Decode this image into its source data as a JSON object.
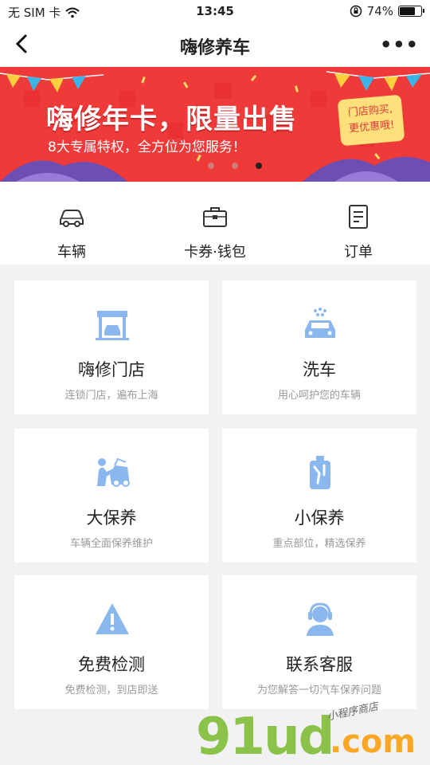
{
  "statusbar": {
    "carrier": "无 SIM 卡",
    "time": "13:45",
    "battery": "74%",
    "battery_level": 0.74
  },
  "navbar": {
    "title": "嗨修养车",
    "more": "•••"
  },
  "banner": {
    "headline": "嗨修年卡，限量出售",
    "subtitle": "8大专属特权，全方位为您服务！",
    "badge_line1": "门店购买,",
    "badge_line2": "更优惠哦!",
    "active_dot": 2,
    "bg_color": "#ef3a3a"
  },
  "quick": [
    {
      "label": "车辆",
      "icon": "car-icon"
    },
    {
      "label": "卡券·钱包",
      "icon": "briefcase-icon"
    },
    {
      "label": "订单",
      "icon": "document-icon"
    }
  ],
  "services": [
    {
      "title": "嗨修门店",
      "desc": "连锁门店，遍布上海",
      "icon": "garage-icon"
    },
    {
      "title": "洗车",
      "desc": "用心呵护您的车辆",
      "icon": "car-wash-icon"
    },
    {
      "title": "大保养",
      "desc": "车辆全面保养维护",
      "icon": "mechanic-icon"
    },
    {
      "title": "小保养",
      "desc": "重点部位，精选保养",
      "icon": "oil-can-icon"
    },
    {
      "title": "免费检测",
      "desc": "免费检测，到店即送",
      "icon": "warning-icon"
    },
    {
      "title": "联系客服",
      "desc": "为您解答一切汽车保养问题",
      "icon": "headset-icon"
    }
  ],
  "watermark": {
    "main": "91ud",
    "suffix": ".com",
    "small": "小程序商店"
  },
  "colors": {
    "icon_blue": "#8ab8ee",
    "text_gray": "#999999"
  }
}
